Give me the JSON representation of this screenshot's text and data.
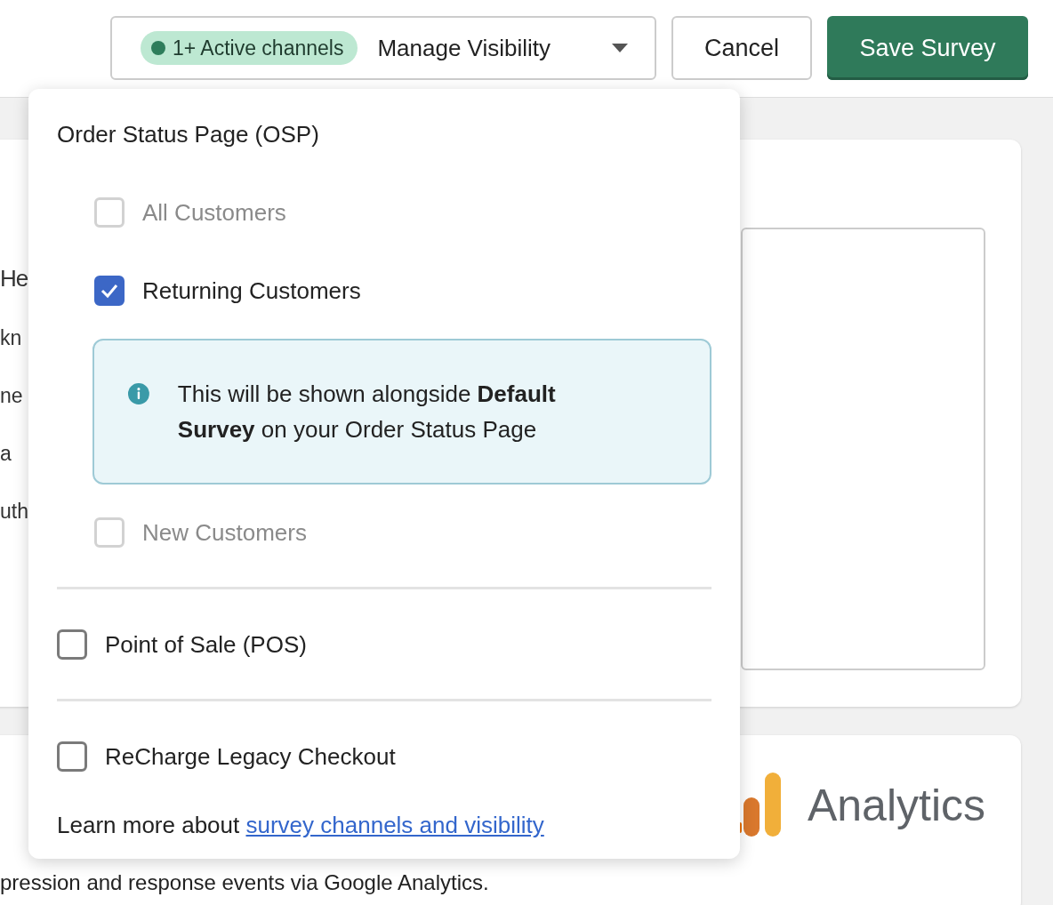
{
  "header": {
    "active_badge": {
      "label": "1+ Active channels",
      "color": "#2e7d5b"
    },
    "manage_button": "Manage Visibility",
    "cancel_button": "Cancel",
    "save_button": "Save Survey"
  },
  "background": {
    "fragments": [
      "He",
      "kn",
      "ne",
      "a",
      "uth"
    ],
    "analytics_logo": "Analytics",
    "description": "pression and response events via Google Analytics."
  },
  "visibility_menu": {
    "sections": [
      {
        "kind": "group",
        "label": "Order Status Page (OSP)",
        "options": [
          {
            "kind": "checkbox",
            "label": "All Customers",
            "checked": false,
            "disabled": true
          },
          {
            "kind": "checkbox",
            "label": "Returning Customers",
            "checked": true,
            "disabled": false
          },
          {
            "kind": "info",
            "text": "This will be shown alongside **Default Survey** on your Order Status Page"
          },
          {
            "kind": "checkbox",
            "label": "New Customers",
            "checked": false,
            "disabled": true
          }
        ]
      },
      {
        "kind": "checkbox",
        "label": "Point of Sale (POS)",
        "checked": false,
        "disabled": false
      },
      {
        "kind": "checkbox",
        "label": "ReCharge Legacy Checkout",
        "checked": false,
        "disabled": false
      }
    ],
    "footer": {
      "text": "Learn more about",
      "link": "survey channels and visibility"
    }
  }
}
